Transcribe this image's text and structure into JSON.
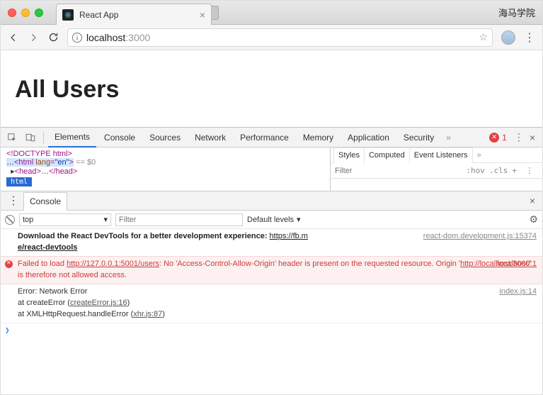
{
  "window": {
    "tab_title": "React App",
    "right_text": "海马学院"
  },
  "nav": {
    "url_host": "localhost",
    "url_path": ":3000"
  },
  "page": {
    "heading": "All Users"
  },
  "devtools": {
    "tabs": [
      "Elements",
      "Console",
      "Sources",
      "Network",
      "Performance",
      "Memory",
      "Application",
      "Security"
    ],
    "active_tab": 0,
    "error_count": "1",
    "elements": {
      "line1": "<!DOCTYPE html>",
      "line2": {
        "pre": "…",
        "tag": "html",
        "attr": "lang",
        "val": "\"en\"",
        "post": " == $0"
      },
      "line3": {
        "open": "<head>",
        "mid": "…",
        "close": "</head>"
      },
      "path": "html"
    },
    "styles": {
      "tabs": [
        "Styles",
        "Computed",
        "Event Listeners"
      ],
      "filter_placeholder": "Filter",
      "btns": [
        ":hov",
        ".cls",
        "+"
      ]
    },
    "drawer": {
      "tab": "Console"
    },
    "console_toolbar": {
      "context": "top",
      "filter_placeholder": "Filter",
      "levels": "Default levels"
    },
    "messages": {
      "m1": {
        "bold": "Download the React DevTools for a better development experience: ",
        "link1": "https://fb.m",
        "link2": "e/react-devtools",
        "src": "react-dom.development.js:15374"
      },
      "m2": {
        "pre": "Failed to load ",
        "url": "http://127.0.0.1:5001/users",
        "mid": ": No 'Access-Control-Allow-Origin' header is present on the requested resource. Origin '",
        "origin": "http://localhost:3000",
        "post": "' is therefore not allowed access.",
        "src": "localhost/:1"
      },
      "m3": {
        "l1": "Error: Network Error",
        "l2a": "    at createError (",
        "l2b": "createError.js:16",
        "l3a": "    at XMLHttpRequest.handleError (",
        "l3b": "xhr.js:87",
        "src": "index.js:14"
      }
    },
    "prompt": "❯"
  }
}
